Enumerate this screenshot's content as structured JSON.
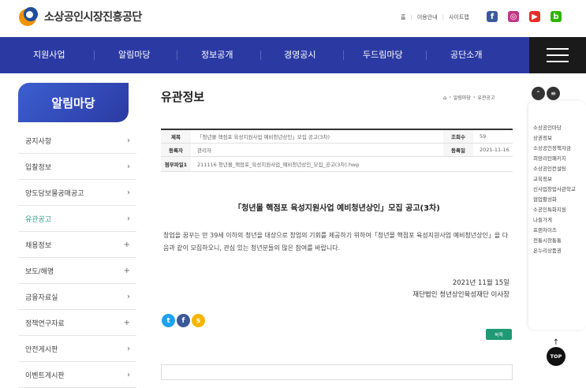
{
  "header": {
    "logo_text": "소상공인시장진흥공단",
    "util": [
      "홈",
      "이용안내",
      "사이트맵"
    ],
    "sns": [
      {
        "name": "facebook",
        "glyph": "f",
        "color": "#3b5998"
      },
      {
        "name": "instagram",
        "glyph": "◎",
        "color": "#c13584"
      },
      {
        "name": "youtube",
        "glyph": "▶",
        "color": "#e52d27"
      },
      {
        "name": "blog",
        "glyph": "b",
        "color": "#2db400"
      }
    ]
  },
  "nav": {
    "items": [
      "지원사업",
      "알림마당",
      "정보공개",
      "경영공시",
      "두드림마당",
      "공단소개"
    ]
  },
  "sidebar": {
    "title": "알림마당",
    "items": [
      {
        "label": "공지사항",
        "icon": "›"
      },
      {
        "label": "입찰정보",
        "icon": "›"
      },
      {
        "label": "양도담보물공매공고",
        "icon": "›"
      },
      {
        "label": "유관공고",
        "icon": "›"
      },
      {
        "label": "채용정보",
        "icon": "+"
      },
      {
        "label": "보도/해명",
        "icon": "+"
      },
      {
        "label": "금융자료실",
        "icon": "›"
      },
      {
        "label": "정책연구자료",
        "icon": "+"
      },
      {
        "label": "안전게시판",
        "icon": "›"
      },
      {
        "label": "이벤트게시판",
        "icon": "›"
      }
    ]
  },
  "main": {
    "page_title": "유관정보",
    "breadcrumb": [
      "알림마당",
      "유관공고"
    ],
    "info": {
      "subject_label": "제목",
      "subject": "「청년몰 핵점포 육성지원사업 예비청년상인」모집 공고(3차)",
      "views_label": "조회수",
      "views": "59",
      "author_label": "등록자",
      "author": "관리자",
      "date_label": "등록일",
      "date": "2021-11-16",
      "attach_label": "첨부파일1",
      "attach": "211116 청년몰_핵점포_육성지원사업_예비청년상인_모집_공고(3차).hwp"
    },
    "post_title": "「청년몰 핵점포 육성지원사업 예비청년상인」모집 공고(3차)",
    "body": "창업을 꿈꾸는 만 39세 이하의 청년을 대상으로 창업의 기회를 제공하기 위하여「청년몰 핵점포 육성지원사업 예비청년상인」을 다음과 같이 모집하오니, 관심 있는 청년분들의 많은 참여를 바랍니다.",
    "sign_date": "2021년 11월 15일",
    "sign_org": "재단법인 청년상인육성재단 이사장",
    "share": [
      {
        "name": "twitter",
        "glyph": "t",
        "color": "#1da1f2"
      },
      {
        "name": "facebook",
        "glyph": "f",
        "color": "#3b5998"
      },
      {
        "name": "kakaostory",
        "glyph": "s",
        "color": "#f7b500"
      }
    ],
    "list_button": "목록"
  },
  "quick": {
    "links": [
      "소상공인마당",
      "상권정보",
      "소상공인정책자금",
      "희망리턴패키지",
      "소상공인컨설팅",
      "교육정보",
      "신사업창업사관학교",
      "협업활성화",
      "소공인특화지원",
      "나들가게",
      "프랜차이즈",
      "전통시장통통",
      "온누리상품권"
    ],
    "top_label": "TOP"
  }
}
